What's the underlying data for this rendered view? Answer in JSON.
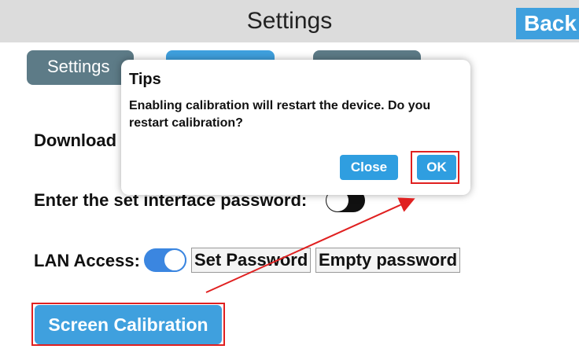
{
  "header": {
    "title": "Settings",
    "back_label": "Back"
  },
  "tabs": [
    {
      "label": "Settings",
      "active": true
    },
    {
      "label": "",
      "active": false
    },
    {
      "label": "",
      "active": false
    }
  ],
  "rows": {
    "download_label": "Download",
    "password_label": "Enter the set interface password:",
    "password_toggle_on": false,
    "lan_label": "LAN Access:",
    "lan_toggle_on": true,
    "set_password_label": "Set Password",
    "empty_password_label": "Empty password",
    "calibration_label": "Screen Calibration"
  },
  "dialog": {
    "title": "Tips",
    "message": "Enabling calibration will restart the device. Do you restart calibration?",
    "close_label": "Close",
    "ok_label": "OK"
  },
  "colors": {
    "accent_blue": "#3fa0de",
    "tab_gray": "#5d7b87",
    "highlight_red": "#e02020"
  }
}
